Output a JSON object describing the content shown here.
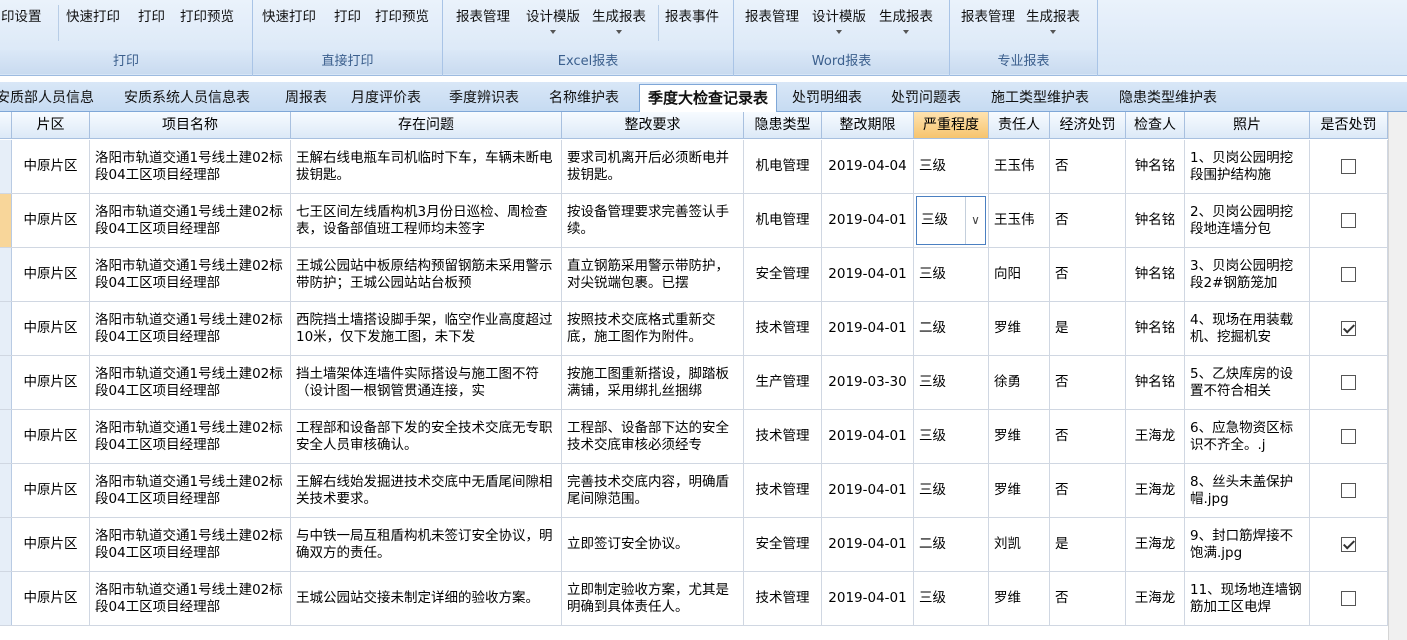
{
  "ribbon": {
    "groups": [
      {
        "caption": "打印",
        "buttons": [
          "印设置",
          "快速打印",
          "打印",
          "打印预览"
        ]
      },
      {
        "caption": "直接打印",
        "buttons": [
          "快速打印",
          "打印",
          "打印预览"
        ]
      },
      {
        "caption": "Excel报表",
        "buttons": [
          "报表管理",
          "设计模版",
          "生成报表",
          "报表事件"
        ]
      },
      {
        "caption": "Word报表",
        "buttons": [
          "报表管理",
          "设计模版",
          "生成报表"
        ]
      },
      {
        "caption": "专业报表",
        "buttons": [
          "报表管理",
          "生成报表"
        ]
      }
    ]
  },
  "tabs": [
    "安质部人员信息",
    "安质系统人员信息表",
    "周报表",
    "月度评价表",
    "季度辨识表",
    "名称维护表",
    "季度大检查记录表",
    "处罚明细表",
    "处罚问题表",
    "施工类型维护表",
    "隐患类型维护表"
  ],
  "active_tab": "季度大检查记录表",
  "columns": [
    "片区",
    "项目名称",
    "存在问题",
    "整改要求",
    "隐患类型",
    "整改期限",
    "严重程度",
    "责任人",
    "经济处罚",
    "检查人",
    "照片",
    "是否处罚"
  ],
  "rows": [
    {
      "area": "中原片区",
      "project": "洛阳市轨道交通1号线土建02标段04工区项目经理部",
      "issue": "王解右线电瓶车司机临时下车，车辆未断电拔钥匙。",
      "req": "要求司机离开后必须断电并拔钥匙。",
      "type": "机电管理",
      "deadline": "2019-04-04",
      "severity": "三级",
      "owner": "王玉伟",
      "fine": "否",
      "inspector": "钟名铭",
      "photo": "1、贝岗公园明挖段围护结构施",
      "penalty": false
    },
    {
      "area": "中原片区",
      "project": "洛阳市轨道交通1号线土建02标段04工区项目经理部",
      "issue": "七王区间左线盾构机3月份日巡检、周检查表，设备部值班工程师均未签字",
      "req": "按设备管理要求完善签认手续。",
      "type": "机电管理",
      "deadline": "2019-04-01",
      "severity": "三级",
      "owner": "王玉伟",
      "fine": "否",
      "inspector": "钟名铭",
      "photo": "2、贝岗公园明挖段地连墙分包",
      "penalty": false
    },
    {
      "area": "中原片区",
      "project": "洛阳市轨道交通1号线土建02标段04工区项目经理部",
      "issue": "王城公园站中板原结构预留钢筋未采用警示带防护；王城公园站站台板预",
      "req": "直立钢筋采用警示带防护，对尖锐端包裹。已摆",
      "type": "安全管理",
      "deadline": "2019-04-01",
      "severity": "三级",
      "owner": "向阳",
      "fine": "否",
      "inspector": "钟名铭",
      "photo": "3、贝岗公园明挖段2#钢筋笼加",
      "penalty": false
    },
    {
      "area": "中原片区",
      "project": "洛阳市轨道交通1号线土建02标段04工区项目经理部",
      "issue": "西院挡土墙搭设脚手架，临空作业高度超过10米，仅下发施工图，未下发",
      "req": "按照技术交底格式重新交底，施工图作为附件。",
      "type": "技术管理",
      "deadline": "2019-04-01",
      "severity": "二级",
      "owner": "罗维",
      "fine": "是",
      "inspector": "钟名铭",
      "photo": "4、现场在用装载机、挖掘机安",
      "penalty": true
    },
    {
      "area": "中原片区",
      "project": "洛阳市轨道交通1号线土建02标段04工区项目经理部",
      "issue": "挡土墙架体连墙件实际搭设与施工图不符（设计图一根钢管贯通连接，实",
      "req": "按施工图重新搭设，脚踏板满铺，采用绑扎丝捆绑",
      "type": "生产管理",
      "deadline": "2019-03-30",
      "severity": "三级",
      "owner": "徐勇",
      "fine": "否",
      "inspector": "钟名铭",
      "photo": "5、乙炔库房的设置不符合相关",
      "penalty": false
    },
    {
      "area": "中原片区",
      "project": "洛阳市轨道交通1号线土建02标段04工区项目经理部",
      "issue": "工程部和设备部下发的安全技术交底无专职安全人员审核确认。",
      "req": "工程部、设备部下达的安全技术交底审核必须经专",
      "type": "技术管理",
      "deadline": "2019-04-01",
      "severity": "三级",
      "owner": "罗维",
      "fine": "否",
      "inspector": "王海龙",
      "photo": "6、应急物资区标识不齐全。.j",
      "penalty": false
    },
    {
      "area": "中原片区",
      "project": "洛阳市轨道交通1号线土建02标段04工区项目经理部",
      "issue": "王解右线始发掘进技术交底中无盾尾间隙相关技术要求。",
      "req": "完善技术交底内容，明确盾尾间隙范围。",
      "type": "技术管理",
      "deadline": "2019-04-01",
      "severity": "三级",
      "owner": "罗维",
      "fine": "否",
      "inspector": "王海龙",
      "photo": "8、丝头未盖保护帽.jpg",
      "penalty": false
    },
    {
      "area": "中原片区",
      "project": "洛阳市轨道交通1号线土建02标段04工区项目经理部",
      "issue": "与中铁一局互租盾构机未签订安全协议，明确双方的责任。",
      "req": "立即签订安全协议。",
      "type": "安全管理",
      "deadline": "2019-04-01",
      "severity": "二级",
      "owner": "刘凯",
      "fine": "是",
      "inspector": "王海龙",
      "photo": "9、封口筋焊接不饱满.jpg",
      "penalty": true
    },
    {
      "area": "中原片区",
      "project": "洛阳市轨道交通1号线土建02标段04工区项目经理部",
      "issue": "王城公园站交接未制定详细的验收方案。",
      "req": "立即制定验收方案，尤其是明确到具体责任人。",
      "type": "技术管理",
      "deadline": "2019-04-01",
      "severity": "三级",
      "owner": "罗维",
      "fine": "否",
      "inspector": "王海龙",
      "photo": "11、现场地连墙钢筋加工区电焊",
      "penalty": false
    }
  ]
}
